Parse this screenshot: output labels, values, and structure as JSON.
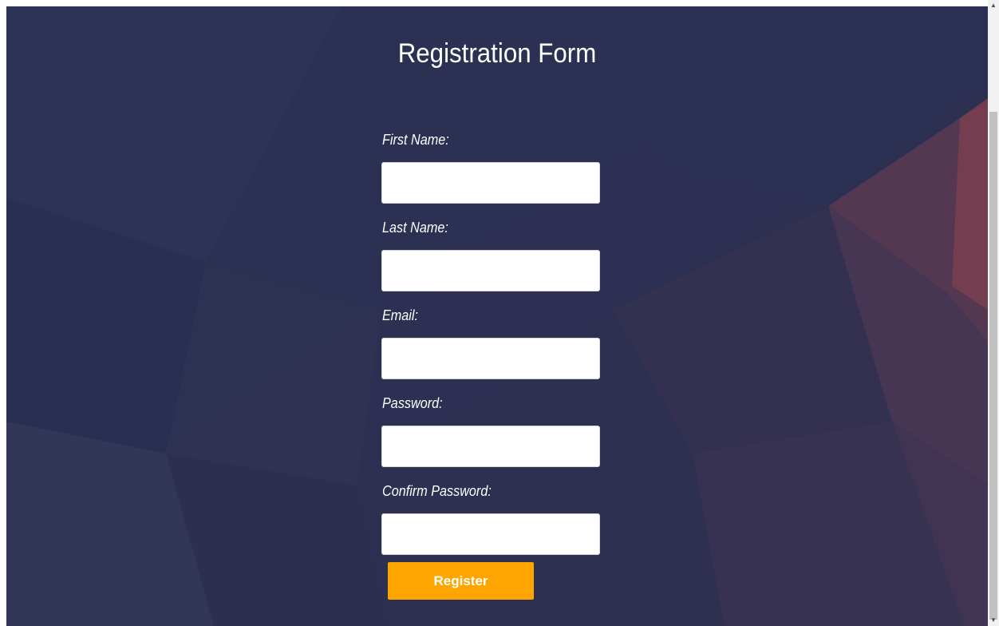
{
  "page": {
    "title": "Registration Form"
  },
  "form": {
    "fields": [
      {
        "label": "First Name:",
        "value": ""
      },
      {
        "label": "Last Name:",
        "value": ""
      },
      {
        "label": "Email:",
        "value": ""
      },
      {
        "label": "Password:",
        "value": ""
      },
      {
        "label": "Confirm Password:",
        "value": ""
      }
    ],
    "submit_label": "Register"
  },
  "colors": {
    "background": "#2b3152",
    "button": "#ffa500",
    "text": "#ffffff"
  },
  "icons": {
    "scroll_up": "scroll-up-arrow-icon",
    "scroll_down": "scroll-down-arrow-icon"
  }
}
